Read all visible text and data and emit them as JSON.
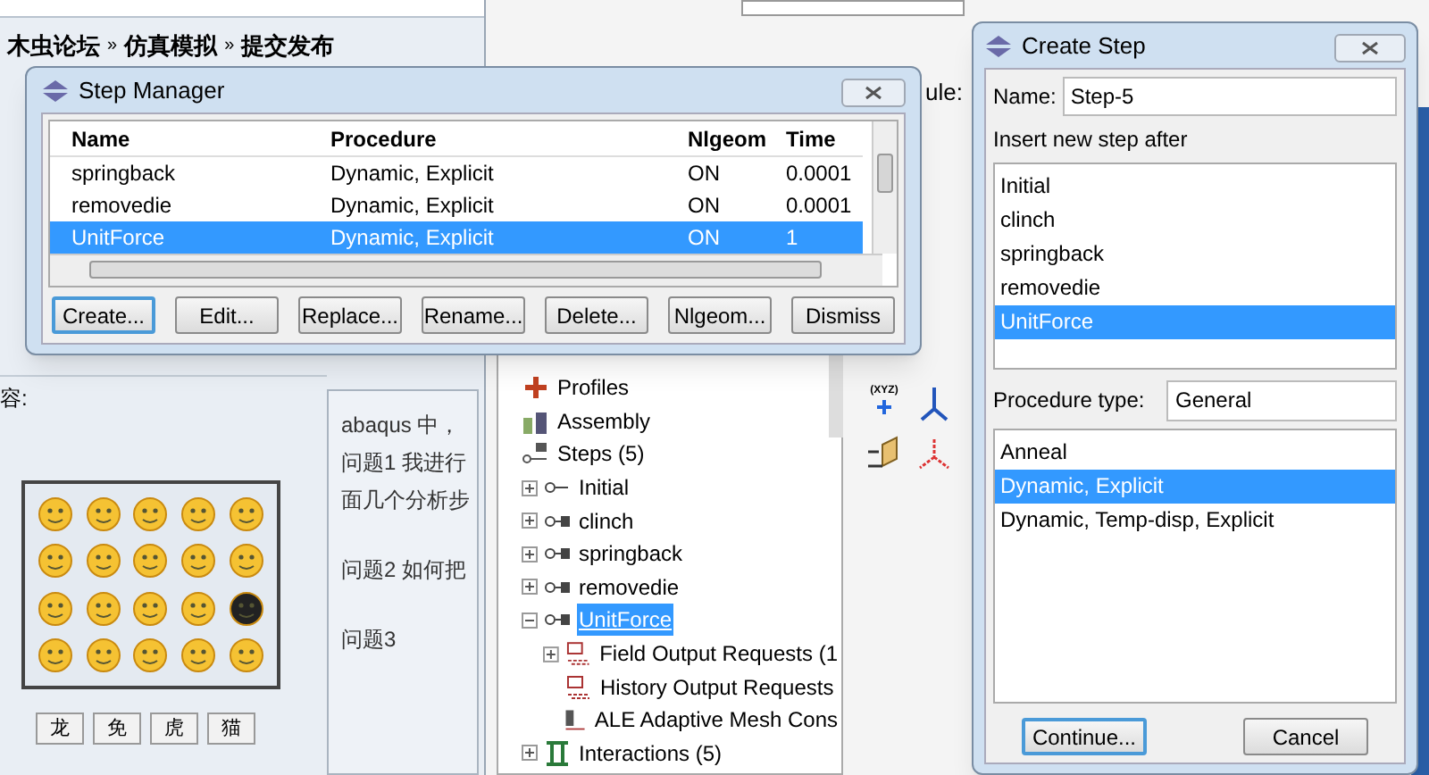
{
  "forum": {
    "breadcrumb": [
      "木虫论坛",
      "仿真模拟",
      "提交发布"
    ],
    "separator": "»",
    "content_label": "容:",
    "emoticon_tabs": [
      {
        "label": "龙"
      },
      {
        "label": "免"
      },
      {
        "label": "虎"
      },
      {
        "label": "猫"
      }
    ],
    "post_paragraphs": [
      [
        "abaqus 中，",
        "问题1  我进行",
        "面几个分析步"
      ],
      [
        "问题2 如何把"
      ],
      [
        "问题3"
      ]
    ]
  },
  "abaqus": {
    "module_label": "ule:",
    "axis_tool_label": "(XYZ)",
    "model_tree": [
      {
        "label": "Profiles",
        "kind": "profile"
      },
      {
        "label": "Assembly",
        "kind": "assembly"
      },
      {
        "label": "Steps (5)",
        "kind": "steps",
        "children": [
          {
            "label": "Initial",
            "kind": "initial",
            "expanded": false,
            "selected": false
          },
          {
            "label": "clinch",
            "kind": "step",
            "expanded": false,
            "selected": false
          },
          {
            "label": "springback",
            "kind": "step",
            "expanded": false,
            "selected": false
          },
          {
            "label": "removedie",
            "kind": "step",
            "expanded": false,
            "selected": false
          },
          {
            "label": "UnitForce",
            "kind": "step",
            "expanded": true,
            "selected": true,
            "children": [
              {
                "label": "Field Output Requests (1",
                "kind": "output",
                "expanded": false
              },
              {
                "label": "History Output Requests",
                "kind": "output"
              },
              {
                "label": "ALE Adaptive Mesh Cons",
                "kind": "ale"
              }
            ]
          },
          {
            "label": "Interactions (5)",
            "kind": "interaction",
            "expanded": false
          }
        ]
      }
    ]
  },
  "step_manager": {
    "title": "Step Manager",
    "columns": [
      "Name",
      "Procedure",
      "Nlgeom",
      "Time"
    ],
    "rows": [
      {
        "cells": [
          "springback",
          "Dynamic, Explicit",
          "ON",
          "0.0001"
        ],
        "selected": false
      },
      {
        "cells": [
          "removedie",
          "Dynamic, Explicit",
          "ON",
          "0.0001"
        ],
        "selected": false
      },
      {
        "cells": [
          "UnitForce",
          "Dynamic, Explicit",
          "ON",
          "1"
        ],
        "selected": true
      }
    ],
    "buttons": [
      {
        "label": "Create...",
        "default": true
      },
      {
        "label": "Edit...",
        "default": false
      },
      {
        "label": "Replace...",
        "default": false
      },
      {
        "label": "Rename...",
        "default": false
      },
      {
        "label": "Delete...",
        "default": false
      },
      {
        "label": "Nlgeom...",
        "default": false
      },
      {
        "label": "Dismiss",
        "default": false
      }
    ]
  },
  "create_step": {
    "title": "Create Step",
    "name_label": "Name:",
    "name_value": "Step-5",
    "insert_label": "Insert new step after",
    "steps": [
      {
        "label": "Initial",
        "selected": false
      },
      {
        "label": "clinch",
        "selected": false
      },
      {
        "label": "springback",
        "selected": false
      },
      {
        "label": "removedie",
        "selected": false
      },
      {
        "label": "UnitForce",
        "selected": true
      }
    ],
    "procedure_label": "Procedure type:",
    "procedure_value": "General",
    "procedures": [
      {
        "label": "Anneal",
        "selected": false
      },
      {
        "label": "Dynamic, Explicit",
        "selected": true
      },
      {
        "label": "Dynamic, Temp-disp, Explicit",
        "selected": false
      }
    ],
    "buttons": [
      {
        "label": "Continue...",
        "default": true
      },
      {
        "label": "Cancel",
        "default": false
      }
    ]
  }
}
